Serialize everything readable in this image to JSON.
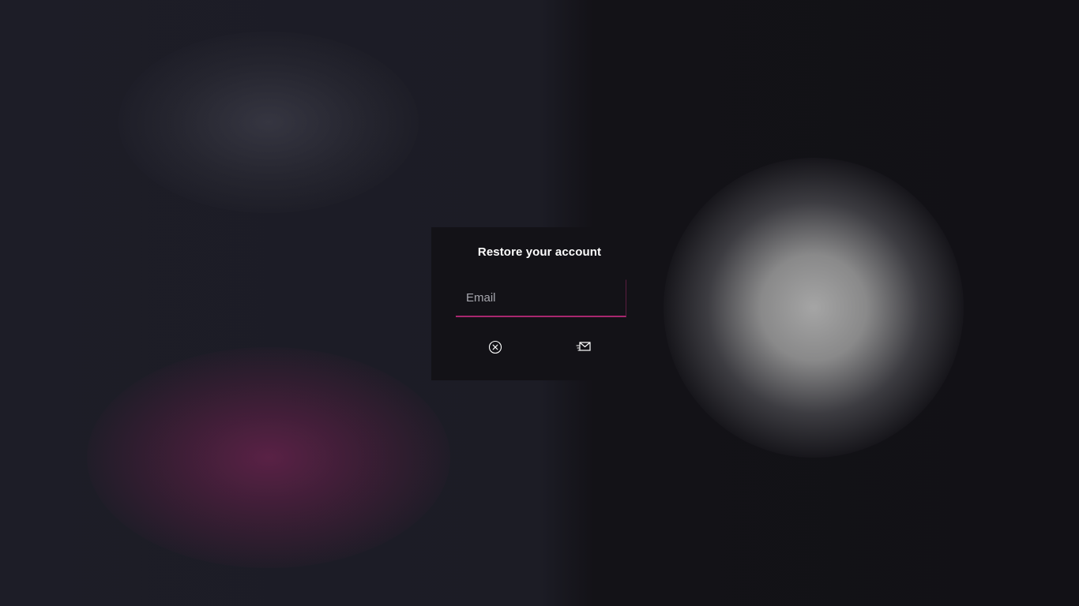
{
  "dialog": {
    "title": "Restore your account",
    "email": {
      "value": "",
      "placeholder": "Email"
    },
    "actions": {
      "cancel_icon": "close-circle-icon",
      "send_icon": "send-mail-icon"
    }
  },
  "colors": {
    "accent": "#a8276f",
    "dialog_bg": "#131217",
    "background": "#1c1c25",
    "title_text": "#ffffff",
    "placeholder_text": "#a7a7ae"
  }
}
